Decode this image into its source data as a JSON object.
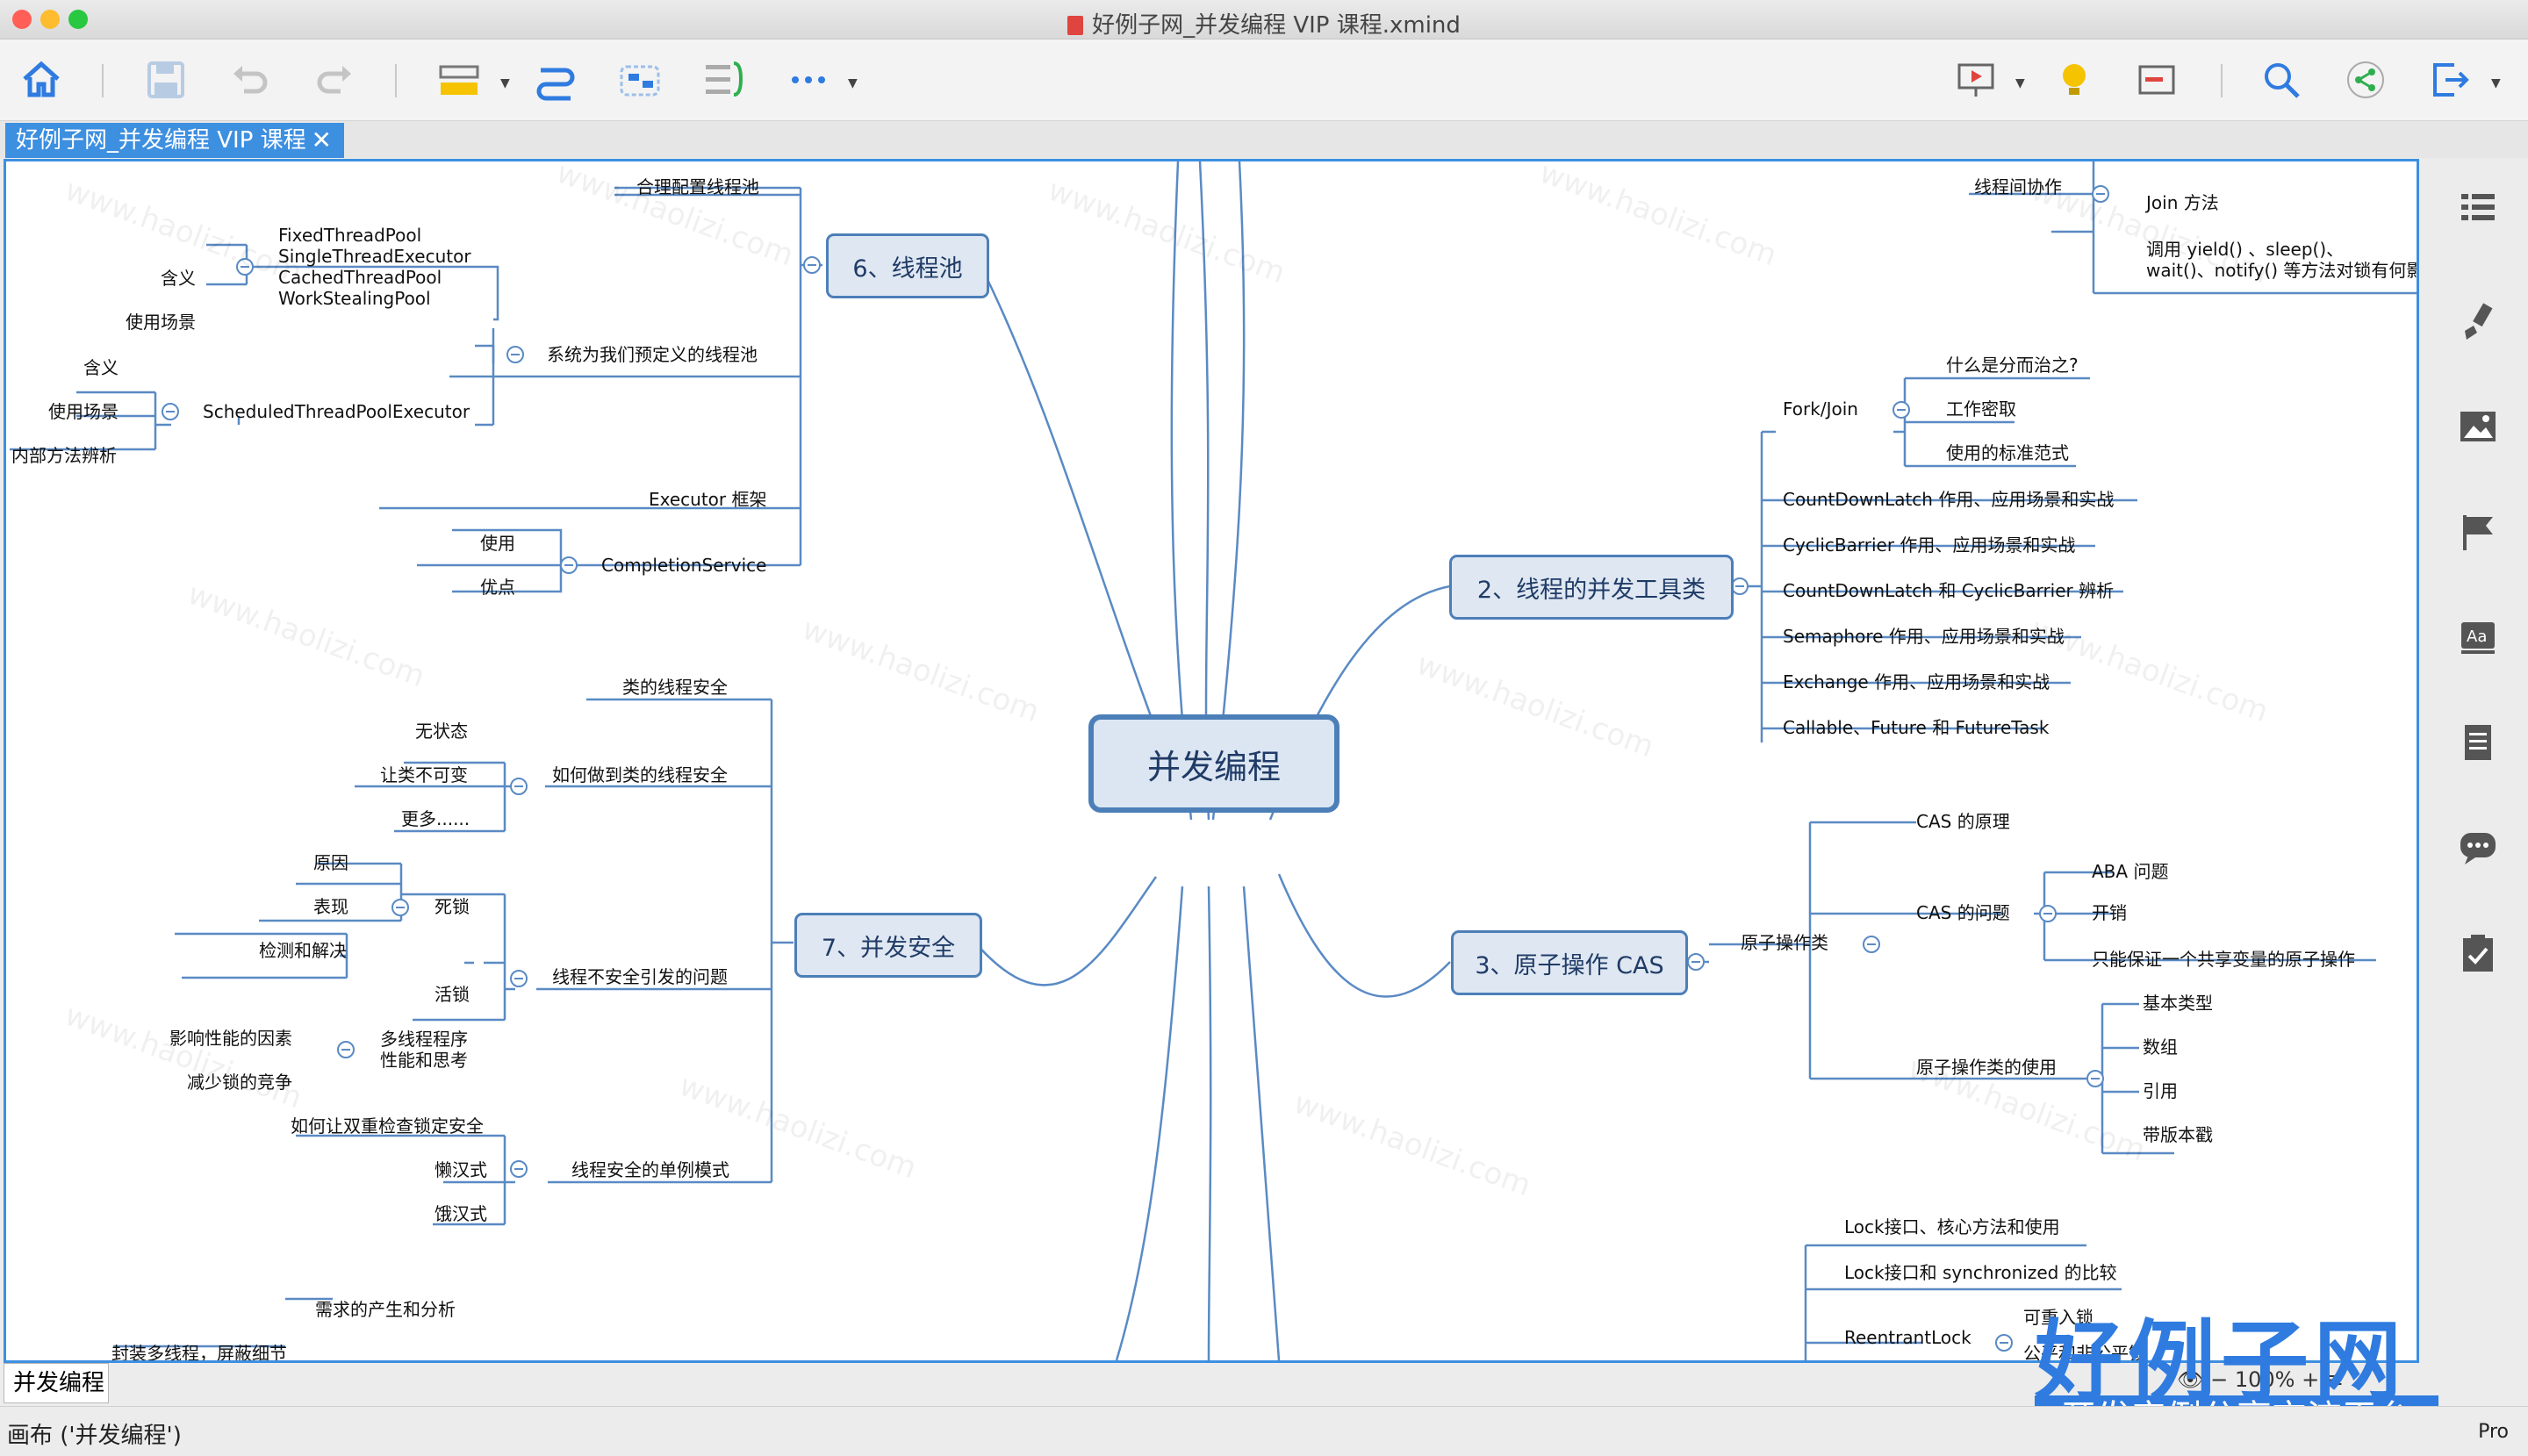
{
  "window": {
    "title": "好例子网_并发编程 VIP 课程.xmind",
    "traffic_colors": [
      "#ff5f57",
      "#febc2e",
      "#28c840"
    ]
  },
  "toolbar": {
    "left_icons": [
      "home-icon",
      "save-icon",
      "undo-icon",
      "redo-icon",
      "topic-style-icon",
      "relationship-icon",
      "boundary-icon",
      "summary-icon",
      "more-icon"
    ],
    "right_icons": [
      "presentation-icon",
      "idea-icon",
      "outline-icon",
      "search-icon",
      "share-icon",
      "export-icon"
    ]
  },
  "tab": {
    "label": "好例子网_并发编程 VIP 课程",
    "close": "✕"
  },
  "sidebar": {
    "icons": [
      "outliner-icon",
      "brush-icon",
      "image-icon",
      "flag-icon",
      "text-format-icon",
      "notes-icon",
      "comment-icon",
      "task-icon"
    ]
  },
  "mindmap": {
    "central": "并发编程",
    "branches": {
      "b2": "2、线程的并发工具类",
      "b3": "3、原子操作 CAS",
      "b6": "6、线程池",
      "b7": "7、并发安全"
    },
    "nodes": [
      "合理配置线程池",
      "FixedThreadPool",
      "SingleThreadExecutor",
      "CachedThreadPool",
      "WorkStealingPool",
      "含义",
      "使用场景",
      "系统为我们预定义的线程池",
      "含义",
      "使用场景",
      "ScheduledThreadPoolExecutor",
      "内部方法辨析",
      "Executor 框架",
      "使用",
      "优点",
      "CompletionService",
      "类的线程安全",
      "无状态",
      "让类不可变",
      "更多......",
      "如何做到类的线程安全",
      "原因",
      "表现",
      "检测和解决",
      "死锁",
      "活锁",
      "线程不安全引发的问题",
      "影响性能的因素",
      "减少锁的竞争",
      "多线程程序\n性能和思考",
      "如何让双重检查锁定安全",
      "懒汉式",
      "饿汉式",
      "线程安全的单例模式",
      "需求的产生和分析",
      "封装多线程，屏蔽细节",
      "线程间协作",
      "Join 方法",
      "调用 yield() 、sleep()、\nwait()、notify() 等方法对锁有何影",
      "Fork/Join",
      "什么是分而治之?",
      "工作密取",
      "使用的标准范式",
      "CountDownLatch 作用、应用场景和实战",
      "CyclicBarrier 作用、应用场景和实战",
      "CountDownLatch 和 CyclicBarrier 辨析",
      "Semaphore 作用、应用场景和实战",
      "Exchange 作用、应用场景和实战",
      "Callable、Future 和 FutureTask",
      "原子操作类",
      "CAS 的原理",
      "CAS 的问题",
      "ABA 问题",
      "开销",
      "只能保证一个共享变量的原子操作",
      "原子操作类的使用",
      "基本类型",
      "数组",
      "引用",
      "带版本戳",
      "Lock接口、核心方法和使用",
      "Lock接口和 synchronized 的比较",
      "ReentrantLock",
      "可重入锁",
      "公平和非公平锁"
    ]
  },
  "watermark": "www.haolizi.com",
  "sheet_tab": "并发编程",
  "zoom": "100%",
  "status": {
    "text": "画布 ('并发编程')",
    "edition": "Pro"
  },
  "logo": {
    "big": "好例子网",
    "small": "开发实例分享交流平台"
  },
  "colors": {
    "accent": "#3d8fe0",
    "branch_border": "#4c7fb8",
    "branch_fill": "#dfe7f2",
    "line": "#5a8ac4"
  }
}
